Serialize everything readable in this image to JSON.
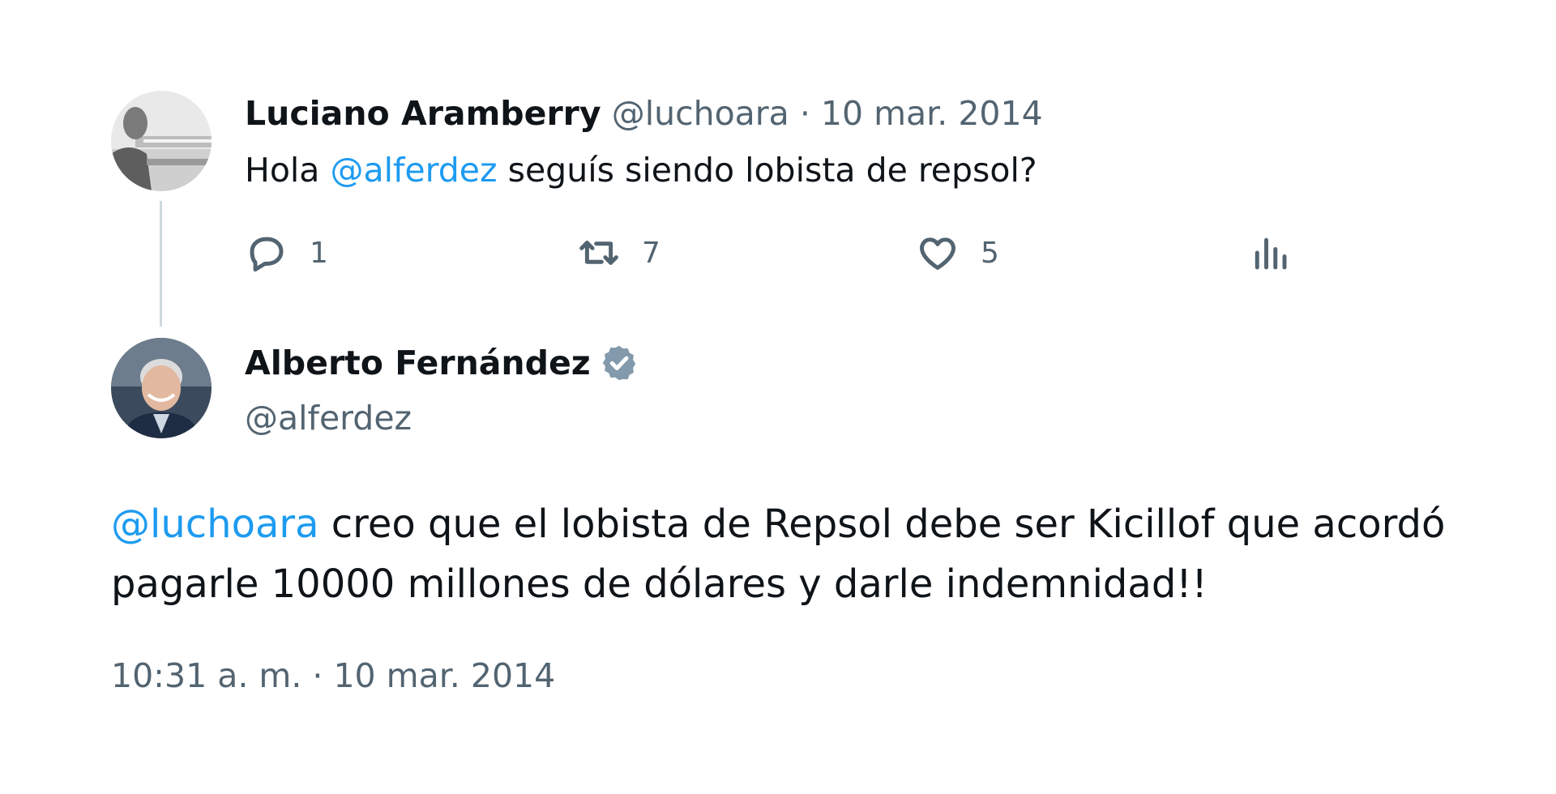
{
  "reply_tweet": {
    "author_name": "Luciano Aramberry",
    "handle": "@luchoara",
    "separator": " · ",
    "date": "10 mar. 2014",
    "text_prefix": "Hola ",
    "mention": "@alferdez",
    "text_suffix": " seguís siendo lobista de repsol?",
    "actions": {
      "reply_count": "1",
      "retweet_count": "7",
      "like_count": "5"
    }
  },
  "main_tweet": {
    "author_name": "Alberto Fernández",
    "handle": "@alferdez",
    "mention": "@luchoara",
    "line1_rest": " creo que el lobista de Repsol debe ser Kicillof que acordó",
    "line2": "pagarle 10000 millones de dólares y darle indemnidad!!",
    "timestamp": "10:31 a. m. · 10 mar. 2014"
  },
  "icons": {
    "reply": "reply-bubble-icon",
    "retweet": "retweet-icon",
    "like": "heart-icon",
    "views": "views-chart-icon",
    "verified": "verified-badge-icon"
  },
  "colors": {
    "mention": "#1d9bf0",
    "muted": "#536471",
    "text": "#0f1419",
    "thread_line": "#cfd9de",
    "verified_badge": "#829aab"
  }
}
